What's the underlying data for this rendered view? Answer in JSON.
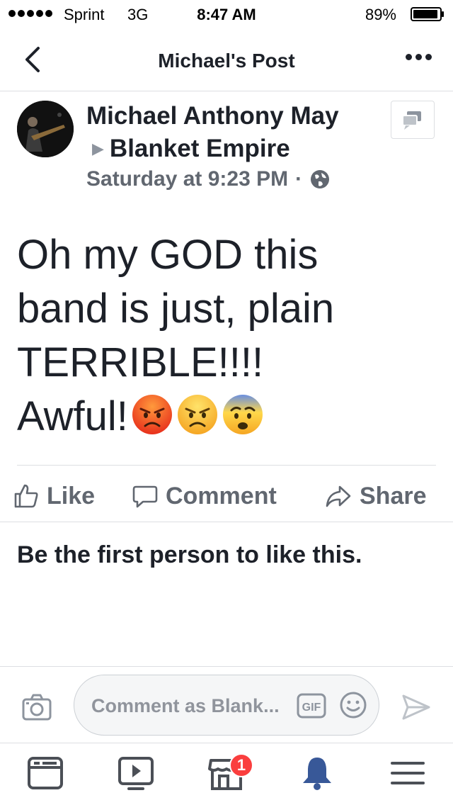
{
  "status_bar": {
    "carrier": "Sprint",
    "network": "3G",
    "time": "8:47 AM",
    "battery": "89%"
  },
  "nav": {
    "title": "Michael's Post"
  },
  "post": {
    "author": "Michael Anthony May",
    "group": "Blanket Empire",
    "timestamp": "Saturday at 9:23 PM",
    "text_lines": [
      "Oh my GOD this",
      "band is just, plain",
      "TERRIBLE!!!!",
      "Awful!"
    ],
    "emoji_icons": [
      "pouting-face-icon",
      "angry-face-icon",
      "fearful-face-icon"
    ],
    "privacy_icon": "globe-icon"
  },
  "actions": {
    "like": "Like",
    "comment": "Comment",
    "share": "Share"
  },
  "reactions_summary": "Be the first person to like this.",
  "composer": {
    "placeholder": "Comment as Blank...",
    "gif_label": "GIF"
  },
  "tabbar": {
    "notification_count": "1",
    "active_color": "#385898",
    "inactive_color": "#4b4f56"
  }
}
